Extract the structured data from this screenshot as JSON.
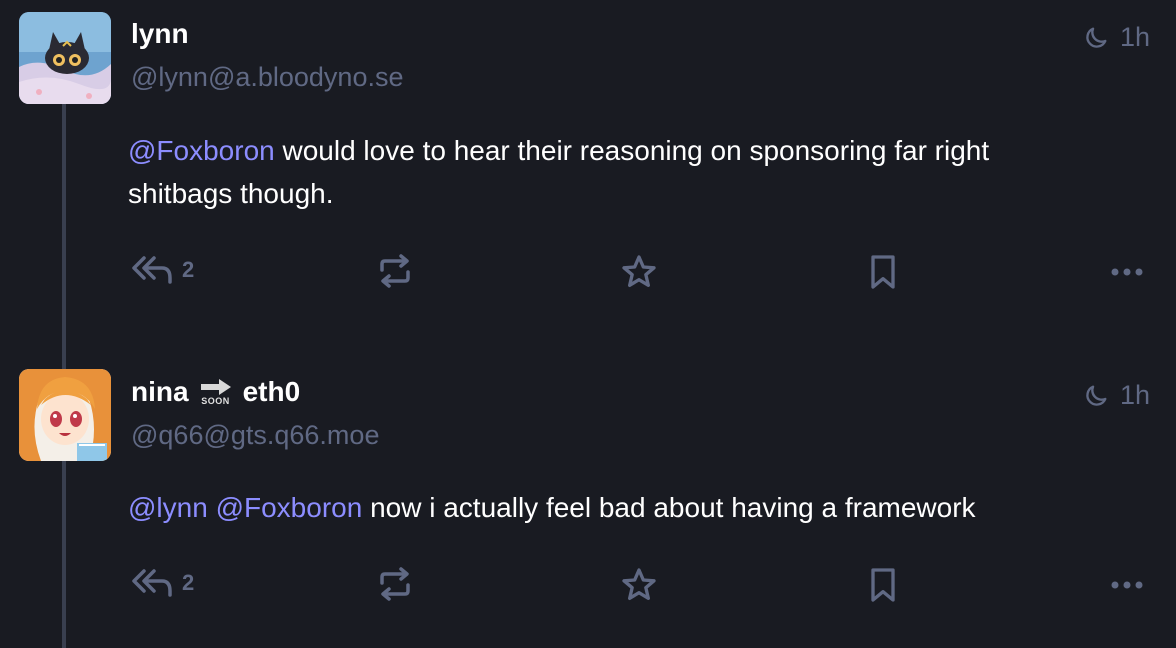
{
  "statuses": [
    {
      "display_name": "lynn",
      "handle": "@lynn@a.bloodyno.se",
      "time": "1h",
      "content": {
        "mention": "@Foxboron",
        "line1": " would love to hear their reasoning on sponsoring far right",
        "line2": "shitbags though."
      },
      "replies_count": "2",
      "avatar_icon": "cat-peeking-avatar"
    },
    {
      "display_name_part1": "nina",
      "emoji_caption": "SOON",
      "display_name_part2": "eth0",
      "handle": "@q66@gts.q66.moe",
      "time": "1h",
      "content": {
        "mention1": "@lynn",
        "mention2": "@Foxboron",
        "text": " now i actually feel bad about having a framework"
      },
      "replies_count": "2",
      "avatar_icon": "anime-girl-avatar"
    }
  ],
  "icons": {
    "reply_all": "reply-all-icon",
    "boost": "boost-icon",
    "favourite": "star-icon",
    "bookmark": "bookmark-icon",
    "more": "more-icon",
    "visibility": "moon-icon"
  },
  "colors": {
    "background": "#191b22",
    "muted": "#606984",
    "mention": "#8c8dff",
    "thread_line": "#393f4f"
  }
}
